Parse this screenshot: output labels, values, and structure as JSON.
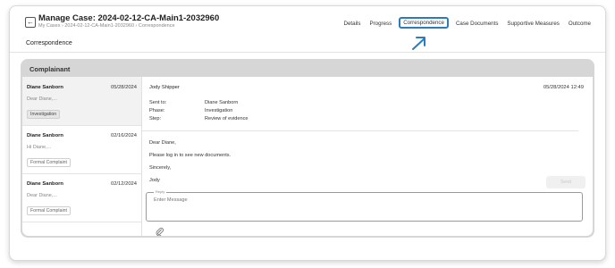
{
  "header": {
    "title": "Manage Case: 2024-02-12-CA-Main1-2032960",
    "breadcrumb": "My Cases › 2024-02-12-CA-Main1-2032960 › Correspondence",
    "back_icon": "←"
  },
  "nav": {
    "items": [
      "Details",
      "Progress",
      "Correspondence",
      "Case Documents",
      "Supportive Measures",
      "Outcome"
    ],
    "active": "Correspondence"
  },
  "page": {
    "subtitle": "Correspondence"
  },
  "panel": {
    "title": "Complainant"
  },
  "threads": [
    {
      "name": "Diane Sanborn",
      "date": "05/28/2024",
      "preview": "Dear Diane,...",
      "tag": "Investigation"
    },
    {
      "name": "Diane Sanborn",
      "date": "02/16/2024",
      "preview": "Hi Diane,...",
      "tag": "Formal Complaint"
    },
    {
      "name": "Diane Sanborn",
      "date": "02/12/2024",
      "preview": "Dear Diane,...",
      "tag": "Formal Complaint"
    }
  ],
  "message": {
    "from": "Jody Shipper",
    "timestamp": "05/28/2024 12:49",
    "sent_to_label": "Sent to:",
    "sent_to": "Diane Sanborn",
    "phase_label": "Phase:",
    "phase": "Investigation",
    "step_label": "Step:",
    "step": "Review of evidence",
    "body": [
      "Dear Diane,",
      "Please log in to see new documents.",
      "Sincerely,",
      "Jody"
    ]
  },
  "reply": {
    "label": "Reply",
    "placeholder": "Enter Message",
    "send_label": "Send"
  },
  "colors": {
    "accent": "#2b7bbf",
    "panel": "#d6d6d6"
  }
}
